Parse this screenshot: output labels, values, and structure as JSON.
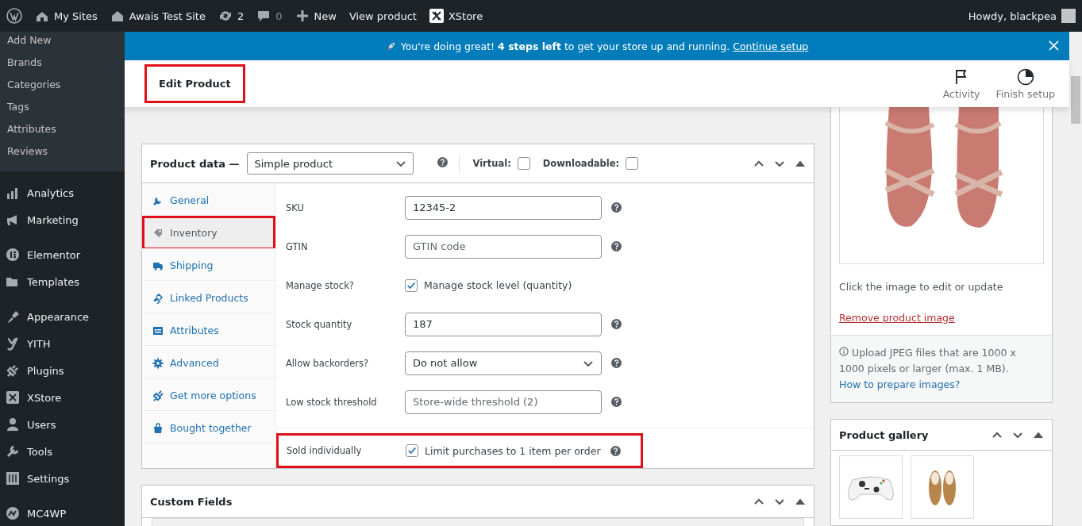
{
  "admin_bar": {
    "items": [
      {
        "label": "My Sites"
      },
      {
        "label": "Awais Test Site"
      },
      {
        "label": "2"
      },
      {
        "label": "0"
      },
      {
        "label": "New"
      },
      {
        "label": "View product"
      },
      {
        "label": "XStore"
      }
    ],
    "greeting": "Howdy, blackpea"
  },
  "sidebar": {
    "submenu": [
      "Add New",
      "Brands",
      "Categories",
      "Tags",
      "Attributes",
      "Reviews"
    ],
    "groups": [
      [
        "Analytics",
        "Marketing"
      ],
      [
        "Elementor",
        "Templates"
      ],
      [
        "Appearance",
        "YITH",
        "Plugins",
        "XStore",
        "Users",
        "Tools",
        "Settings"
      ],
      [
        "MC4WP"
      ]
    ]
  },
  "banner": {
    "text": "You're doing great! **4 steps left** to get your store up and running.",
    "link": "Continue setup"
  },
  "header": {
    "title": "Edit Product",
    "highlighted": true,
    "actions": [
      "Activity",
      "Finish setup"
    ]
  },
  "product_data": {
    "title": "Product data —",
    "type": "Simple product",
    "options": [
      {
        "label": "Virtual:",
        "checked": false
      },
      {
        "label": "Downloadable:",
        "checked": false
      }
    ],
    "tabs": [
      {
        "label": "General",
        "selected": false,
        "highlighted": false
      },
      {
        "label": "Inventory",
        "selected": true,
        "highlighted": true
      },
      {
        "label": "Shipping",
        "selected": false,
        "highlighted": false
      },
      {
        "label": "Linked Products",
        "selected": false,
        "highlighted": false
      },
      {
        "label": "Attributes",
        "selected": false,
        "highlighted": false
      },
      {
        "label": "Advanced",
        "selected": false,
        "highlighted": false
      },
      {
        "label": "Get more options",
        "selected": false,
        "highlighted": false
      },
      {
        "label": "Bought together",
        "selected": false,
        "highlighted": false
      }
    ],
    "fields": [
      {
        "kind": "text",
        "label": "SKU",
        "value": "12345-2",
        "help": true
      },
      {
        "kind": "text",
        "label": "GTIN",
        "placeholder": "GTIN code",
        "help": true
      },
      {
        "kind": "checkbox",
        "label": "Manage stock?",
        "text": "Manage stock level (quantity)",
        "checked": true,
        "help": false
      },
      {
        "kind": "text",
        "label": "Stock quantity",
        "value": "187",
        "help": true
      },
      {
        "kind": "select",
        "label": "Allow backorders?",
        "value": "Do not allow",
        "help": true
      },
      {
        "kind": "text",
        "label": "Low stock threshold",
        "placeholder": "Store-wide threshold (2)",
        "help": true
      }
    ],
    "sold_individually": {
      "label": "Sold individually",
      "text": "Limit purchases to 1 item per order",
      "checked": true,
      "highlighted": true
    }
  },
  "custom_fields": {
    "title": "Custom Fields"
  },
  "featured_image": {
    "hint": "Click the image to edit or update",
    "remove": "Remove product image",
    "notice": "Upload JPEG files that are 1000 x 1000 pixels or larger (max. 1 MB).",
    "notice_link": "How to prepare images?"
  },
  "gallery": {
    "title": "Product gallery"
  }
}
